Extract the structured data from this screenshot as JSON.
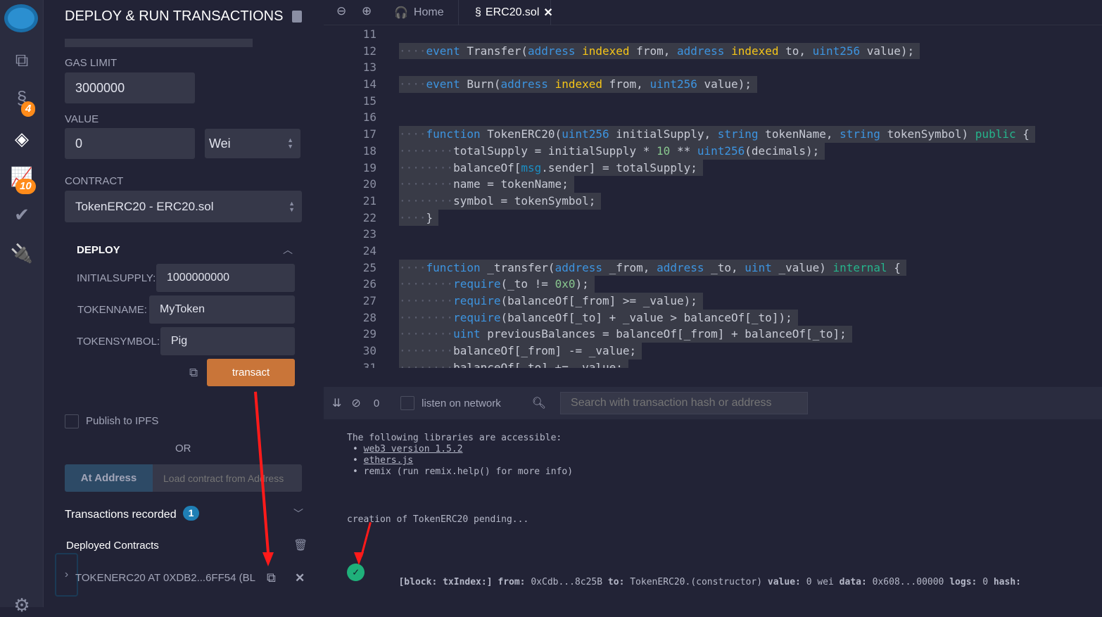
{
  "iconbar": {
    "badges": {
      "compiler": "4",
      "analysis": "10"
    }
  },
  "panel": {
    "title": "DEPLOY & RUN TRANSACTIONS",
    "gas_limit_label": "GAS LIMIT",
    "gas_limit": "3000000",
    "value_label": "VALUE",
    "value": "0",
    "unit": "Wei",
    "contract_label": "CONTRACT",
    "contract": "TokenERC20 - ERC20.sol",
    "deploy_label": "DEPLOY",
    "params": [
      {
        "label": "INITIALSUPPLY:",
        "value": "1000000000"
      },
      {
        "label": "TOKENNAME:",
        "value": "MyToken"
      },
      {
        "label": "TOKENSYMBOL:",
        "value": "Pig"
      }
    ],
    "transact": "transact",
    "publish_ipfs": "Publish to IPFS",
    "or": "OR",
    "at_address": "At Address",
    "at_address_placeholder": "Load contract from Address",
    "tx_recorded": "Transactions recorded",
    "tx_count": "1",
    "deployed": "Deployed Contracts",
    "deployed_item": "TOKENERC20 AT 0XDB2...6FF54 (BL"
  },
  "tabs": [
    {
      "label": "Home"
    },
    {
      "label": "ERC20.sol",
      "active": true
    }
  ],
  "code": [
    {
      "n": "11",
      "indent": 0,
      "t": []
    },
    {
      "n": "12",
      "indent": 4,
      "t": [
        [
          "event",
          "kw"
        ],
        " Transfer(",
        [
          "address",
          "kw"
        ],
        " ",
        [
          "indexed",
          "ind"
        ],
        " from, ",
        [
          "address",
          "kw"
        ],
        " ",
        [
          "indexed",
          "ind"
        ],
        " to, ",
        [
          "uint256",
          "kw"
        ],
        " value);"
      ]
    },
    {
      "n": "13",
      "indent": 0,
      "t": []
    },
    {
      "n": "14",
      "indent": 4,
      "t": [
        [
          "event",
          "kw"
        ],
        " Burn(",
        [
          "address",
          "kw"
        ],
        " ",
        [
          "indexed",
          "ind"
        ],
        " from, ",
        [
          "uint256",
          "kw"
        ],
        " value);"
      ]
    },
    {
      "n": "15",
      "indent": 0,
      "t": []
    },
    {
      "n": "16",
      "indent": 0,
      "t": []
    },
    {
      "n": "17",
      "indent": 4,
      "t": [
        [
          "function",
          "kw"
        ],
        " TokenERC20(",
        [
          "uint256",
          "kw"
        ],
        " initialSupply, ",
        [
          "string",
          "kw"
        ],
        " tokenName, ",
        [
          "string",
          "kw"
        ],
        " tokenSymbol) ",
        [
          "public",
          "grn"
        ],
        " {"
      ]
    },
    {
      "n": "18",
      "indent": 8,
      "t": [
        "totalSupply = initialSupply * ",
        [
          "10",
          "numc"
        ],
        " ** ",
        [
          "uint256",
          "kw"
        ],
        "(decimals);"
      ]
    },
    {
      "n": "19",
      "indent": 8,
      "t": [
        "balanceOf[",
        [
          "msg",
          "msg"
        ],
        ".sender] = totalSupply;"
      ]
    },
    {
      "n": "20",
      "indent": 8,
      "t": [
        "name = tokenName;"
      ]
    },
    {
      "n": "21",
      "indent": 8,
      "t": [
        "symbol = tokenSymbol;"
      ]
    },
    {
      "n": "22",
      "indent": 4,
      "t": [
        "}"
      ]
    },
    {
      "n": "23",
      "indent": 0,
      "t": []
    },
    {
      "n": "24",
      "indent": 0,
      "t": []
    },
    {
      "n": "25",
      "indent": 4,
      "t": [
        [
          "function",
          "kw"
        ],
        " _transfer(",
        [
          "address",
          "kw"
        ],
        " _from, ",
        [
          "address",
          "kw"
        ],
        " _to, ",
        [
          "uint",
          "kw"
        ],
        " _value) ",
        [
          "internal",
          "grn"
        ],
        " {"
      ]
    },
    {
      "n": "26",
      "indent": 8,
      "t": [
        [
          "require",
          "kw"
        ],
        "(_to != ",
        [
          "0x0",
          "numc"
        ],
        ");"
      ]
    },
    {
      "n": "27",
      "indent": 8,
      "t": [
        [
          "require",
          "kw"
        ],
        "(balanceOf[_from] >= _value);"
      ]
    },
    {
      "n": "28",
      "indent": 8,
      "t": [
        [
          "require",
          "kw"
        ],
        "(balanceOf[_to] + _value > balanceOf[_to]);"
      ]
    },
    {
      "n": "29",
      "indent": 8,
      "t": [
        [
          "uint",
          "kw"
        ],
        " previousBalances = balanceOf[_from] + balanceOf[_to];"
      ]
    },
    {
      "n": "30",
      "indent": 8,
      "t": [
        "balanceOf[_from] -= _value;"
      ]
    },
    {
      "n": "31",
      "indent": 8,
      "t": [
        "balanceOf[_to] += _value;"
      ]
    }
  ],
  "terminal": {
    "count": "0",
    "listen": "listen on network",
    "search_placeholder": "Search with transaction hash or address",
    "intro": "The following libraries are accessible:",
    "libs": [
      "web3 version 1.5.2",
      "ethers.js"
    ],
    "remix": "remix (run remix.help() for more info)",
    "pending": "creation of TokenERC20 pending...",
    "tx": {
      "block_label": "[block: txIndex:]",
      "from_label": "from:",
      "from": "0xCdb...8c25B",
      "to_label": "to:",
      "to": "TokenERC20.(constructor)",
      "value_label": "value:",
      "value": "0 wei",
      "data_label": "data:",
      "data": "0x608...00000",
      "logs_label": "logs:",
      "logs": "0",
      "hash_label": "hash:"
    }
  },
  "colors": {
    "accent": "#c97539",
    "success": "#1fb07a",
    "annotation": "#ff1a1a"
  }
}
